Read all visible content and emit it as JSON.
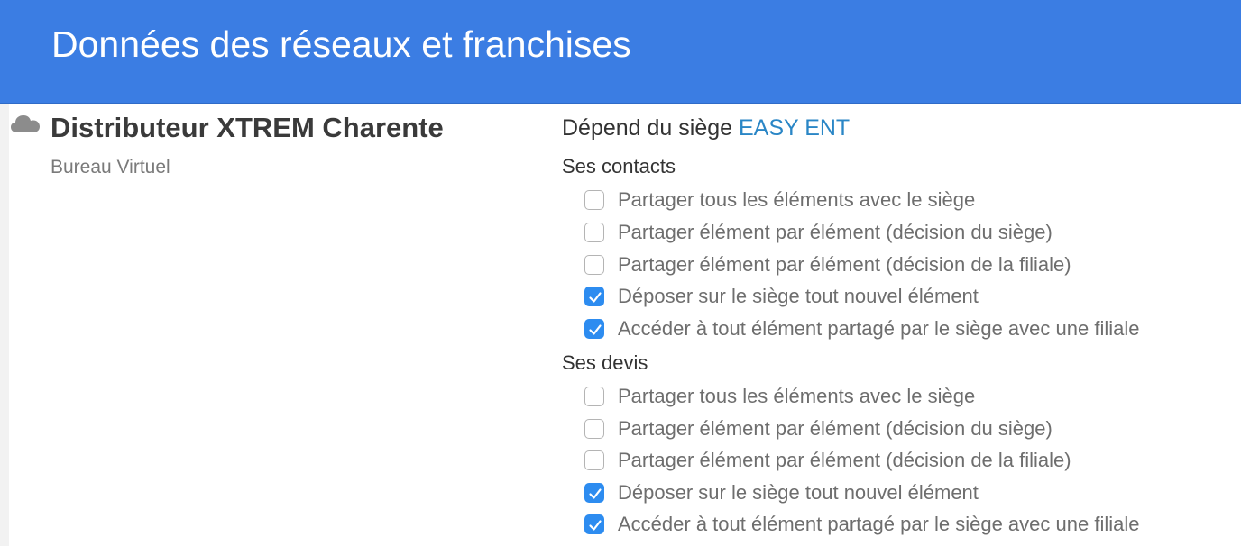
{
  "header": {
    "title": "Données des réseaux et franchises"
  },
  "entity": {
    "icon": "cloud-icon",
    "name": "Distributeur XTREM Charente",
    "subtitle": "Bureau Virtuel"
  },
  "hq": {
    "prefix": "Dépend du siège",
    "link_label": "EASY ENT"
  },
  "sections": [
    {
      "title": "Ses contacts",
      "options": [
        {
          "label": "Partager tous les éléments avec le siège",
          "checked": false
        },
        {
          "label": "Partager élément par élément (décision du siège)",
          "checked": false
        },
        {
          "label": "Partager élément par élément (décision de la filiale)",
          "checked": false
        },
        {
          "label": "Déposer sur le siège tout nouvel élément",
          "checked": true
        },
        {
          "label": "Accéder à tout élément partagé par le siège avec une filiale",
          "checked": true
        }
      ]
    },
    {
      "title": "Ses devis",
      "options": [
        {
          "label": "Partager tous les éléments avec le siège",
          "checked": false
        },
        {
          "label": "Partager élément par élément (décision du siège)",
          "checked": false
        },
        {
          "label": "Partager élément par élément (décision de la filiale)",
          "checked": false
        },
        {
          "label": "Déposer sur le siège tout nouvel élément",
          "checked": true
        },
        {
          "label": "Accéder à tout élément partagé par le siège avec une filiale",
          "checked": true
        }
      ]
    }
  ],
  "colors": {
    "header_bg": "#3b7de3",
    "link": "#2a86c6",
    "checkbox_checked": "#2d8cf0"
  }
}
